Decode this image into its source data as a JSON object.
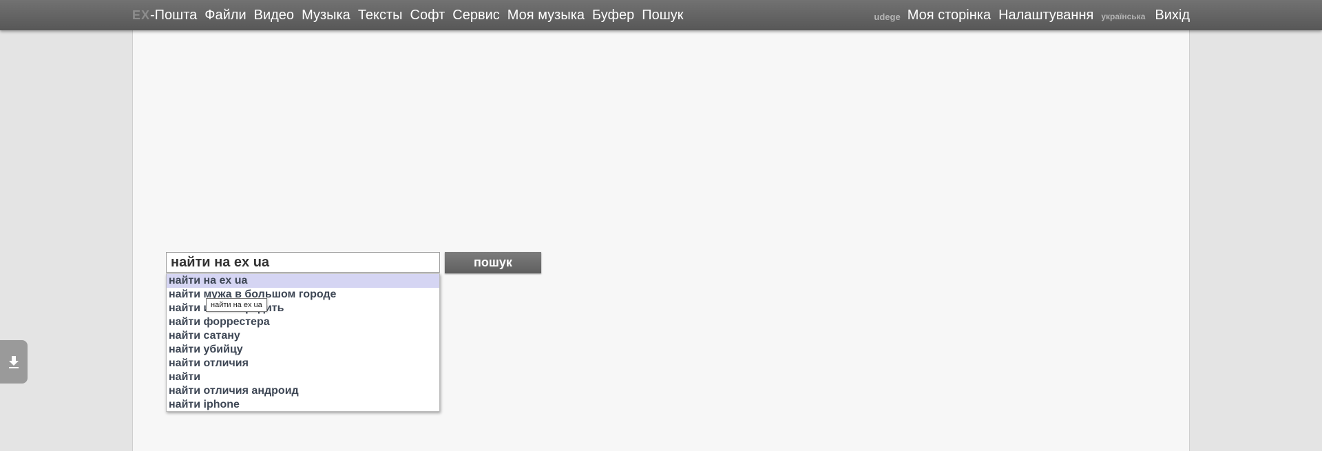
{
  "header": {
    "logo": "EX",
    "nav": [
      "-Пошта",
      "Файли",
      "Видео",
      "Музыка",
      "Тексты",
      "Софт",
      "Сервис",
      "Моя музыка",
      "Буфер",
      "Пошук"
    ],
    "user": "udege",
    "my_page": "Моя сторінка",
    "settings": "Налаштування",
    "language": "українська",
    "logout": "Вихід"
  },
  "search": {
    "value": "найти на ex ua",
    "button": "пошук",
    "suggestions": [
      "найти на ex ua",
      "найти мужа в большом городе",
      "найти и обезвредить",
      "найти форрестера",
      "найти сатану",
      "найти убийцу",
      "найти отличия",
      "найти",
      "найти отличия андроид",
      "найти iphone"
    ],
    "tooltip": "найти на ex ua"
  },
  "colors": {
    "topbar": "#636363",
    "content_bg": "#f7f7f7",
    "suggestion_highlight": "#d5d5f3",
    "button": "#6d6d6d"
  },
  "icons": {
    "side_tab": "download-icon"
  }
}
